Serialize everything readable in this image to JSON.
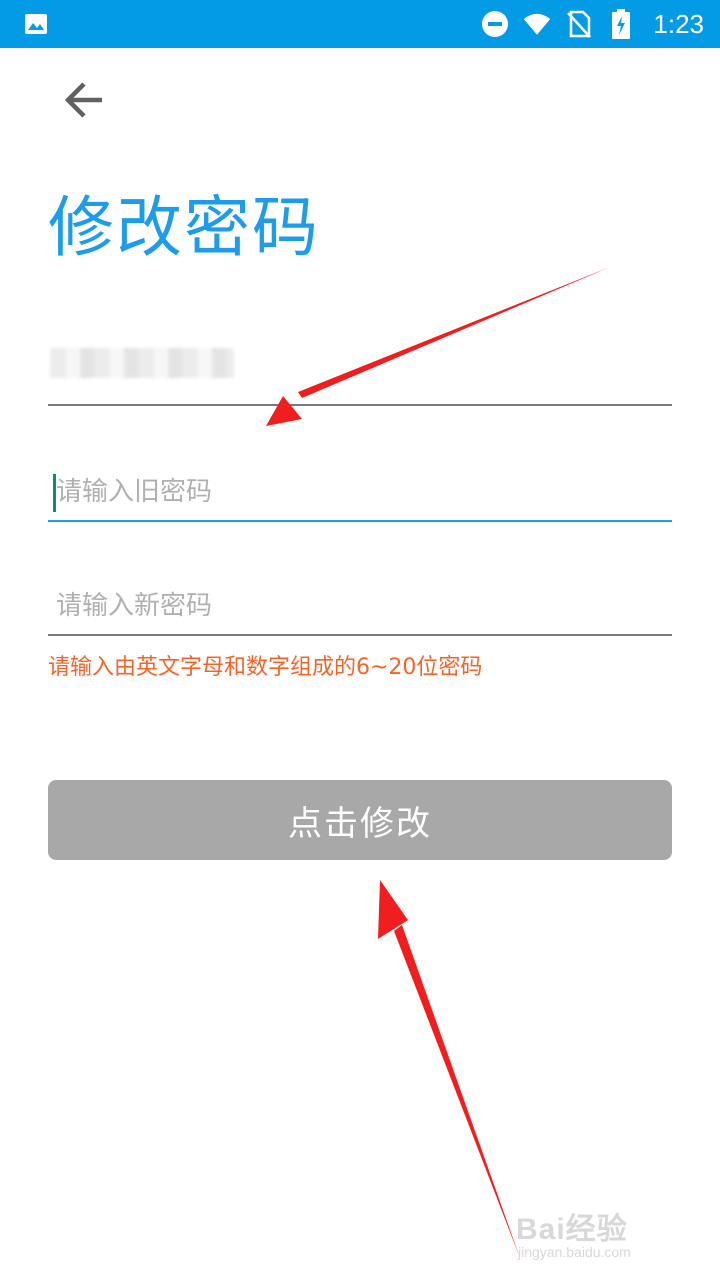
{
  "status_bar": {
    "time": "1:23",
    "color": "#039be5",
    "icons": [
      "gallery-icon",
      "dnd-icon",
      "wifi-icon",
      "no-sim-icon",
      "battery-charging-icon"
    ]
  },
  "header": {
    "back_icon": "arrow-back-icon",
    "title": "修改密码",
    "title_color": "#1e9ce8"
  },
  "form": {
    "account": {
      "value": "(blurred)"
    },
    "old_password": {
      "placeholder": "请输入旧密码",
      "value": ""
    },
    "new_password": {
      "placeholder": "请输入新密码",
      "value": ""
    },
    "hint": "请输入由英文字母和数字组成的6~20位密码",
    "hint_color": "#f2652a",
    "submit_label": "点击修改",
    "submit_color": "#a8a8a8"
  },
  "annotations": {
    "arrow_color": "#f01e1e"
  },
  "watermark": {
    "main": "Bai经验",
    "sub": "jingyan.baidu.com"
  }
}
